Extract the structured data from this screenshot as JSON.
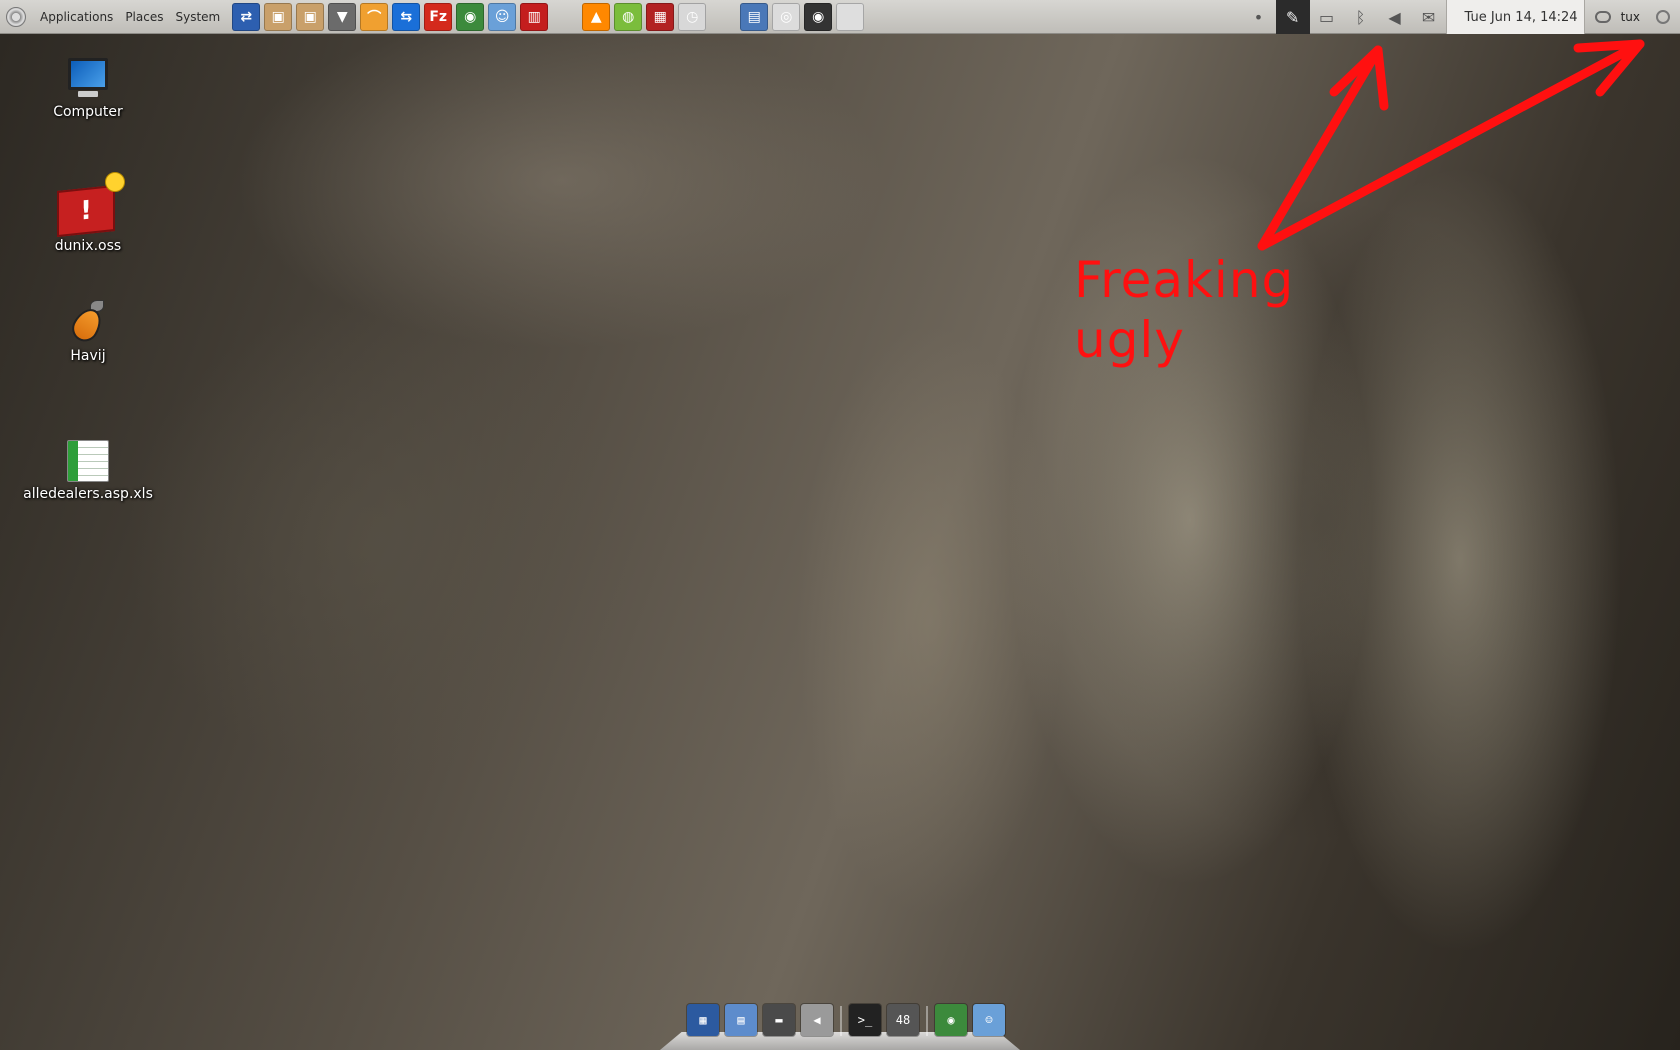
{
  "top_panel": {
    "menus": [
      {
        "label": "Applications"
      },
      {
        "label": "Places"
      },
      {
        "label": "System"
      }
    ],
    "launchers": [
      {
        "icon": "network-manager-icon",
        "color": "#2d5fb0",
        "glyph": "⇄"
      },
      {
        "icon": "package-install-icon",
        "color": "#c9a06a",
        "glyph": "▣"
      },
      {
        "icon": "package-remove-icon",
        "color": "#c9a06a",
        "glyph": "▣"
      },
      {
        "icon": "suit-tie-icon",
        "color": "#6b6b6b",
        "glyph": "▼"
      },
      {
        "icon": "arch-swoosh-icon",
        "color": "#f0a030",
        "glyph": "⌒"
      },
      {
        "icon": "teamviewer-icon",
        "color": "#1a6fd8",
        "glyph": "⇆"
      },
      {
        "icon": "filezilla-icon",
        "color": "#d42a1c",
        "glyph": "Fz"
      },
      {
        "icon": "chrome-icon",
        "color": "#3c8a3c",
        "glyph": "◉"
      },
      {
        "icon": "messenger-icon",
        "color": "#6aa0d8",
        "glyph": "☺"
      },
      {
        "icon": "red-box-app-icon",
        "color": "#c41e1e",
        "glyph": "▥"
      },
      {
        "icon": "vlc-icon",
        "color": "#ff8800",
        "glyph": "▲"
      },
      {
        "icon": "ubuntu-software-icon",
        "color": "#7bbd3c",
        "glyph": "◍"
      },
      {
        "icon": "red-grid-app-icon",
        "color": "#b22222",
        "glyph": "▦"
      },
      {
        "icon": "clock-app-icon",
        "color": "#d8d8d8",
        "glyph": "◷"
      },
      {
        "icon": "workspace-switcher-icon",
        "color": "#4a78b8",
        "glyph": "▤"
      },
      {
        "icon": "cd-drive-icon",
        "color": "#dcdcdc",
        "glyph": "◎"
      },
      {
        "icon": "webcam-icon",
        "color": "#333333",
        "glyph": "◉"
      },
      {
        "icon": "blank-window-icon",
        "color": "#dedede",
        "glyph": ""
      }
    ],
    "tray": [
      {
        "icon": "user-status-icon",
        "glyph": "•"
      },
      {
        "icon": "pen-tool-icon",
        "glyph": "✎"
      },
      {
        "icon": "display-settings-icon",
        "glyph": "▭"
      },
      {
        "icon": "bluetooth-icon",
        "glyph": "ᛒ"
      },
      {
        "icon": "volume-icon",
        "glyph": "◀"
      },
      {
        "icon": "mail-icon",
        "glyph": "✉"
      }
    ],
    "clock": "Tue Jun 14, 14:24",
    "user": "tux"
  },
  "desktop_icons": [
    {
      "label": "Computer",
      "icon": "computer-icon"
    },
    {
      "label": "dunix.oss",
      "icon": "dunix-app-icon"
    },
    {
      "label": "Havij",
      "icon": "havij-carrot-icon"
    },
    {
      "label": "alledealers.asp.xls",
      "icon": "spreadsheet-icon"
    }
  ],
  "annotation": {
    "line1": "Freaking",
    "line2": "ugly",
    "color": "#ff1010"
  },
  "dock": {
    "items": [
      {
        "icon": "desktop-preview-icon",
        "color": "#2c5aa0",
        "glyph": "▦"
      },
      {
        "icon": "workspace-icon",
        "color": "#5d8ccc",
        "glyph": "▤"
      },
      {
        "icon": "folder-icon",
        "color": "#4a4a4a",
        "glyph": "▬"
      },
      {
        "icon": "volume-dock-icon",
        "color": "#9a9a9a",
        "glyph": "◀"
      },
      {
        "icon": "terminal-icon",
        "color": "#222222",
        "glyph": ">_"
      },
      {
        "icon": "speedometer-icon",
        "color": "#555555",
        "glyph": "48"
      },
      {
        "icon": "chrome-dock-icon",
        "color": "#3c8a3c",
        "glyph": "◉"
      },
      {
        "icon": "messenger-dock-icon",
        "color": "#6aa0d8",
        "glyph": "☺"
      }
    ]
  }
}
